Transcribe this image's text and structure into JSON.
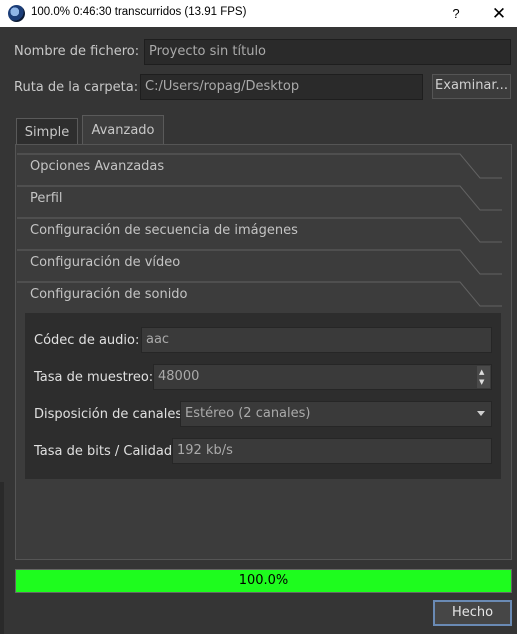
{
  "window": {
    "title": "100.0%  0:46:30 transcurridos (13.91 FPS)",
    "help_glyph": "?",
    "close_glyph": "✕"
  },
  "form": {
    "filename_label": "Nombre de fichero:",
    "filename_value": "Proyecto sin título",
    "folder_label": "Ruta de la carpeta:",
    "folder_value": "C:/Users/ropag/Desktop",
    "browse_label": "Examinar..."
  },
  "tabs": [
    {
      "label": "Simple",
      "selected": false
    },
    {
      "label": "Avanzado",
      "selected": true
    }
  ],
  "sections": [
    "Opciones Avanzadas",
    "Perfil",
    "Configuración de secuencia de imágenes",
    "Configuración de vídeo",
    "Configuración de sonido"
  ],
  "audio": {
    "codec_label": "Códec de audio:",
    "codec_value": "aac",
    "samplerate_label": "Tasa de muestreo:",
    "samplerate_value": "48000",
    "channels_label": "Disposición de canales:",
    "channels_value": "Estéreo (2 canales)",
    "bitrate_label": "Tasa de bits / Calidad:",
    "bitrate_value": "192 kb/s"
  },
  "progress": {
    "percent": 100.0,
    "text": "100.0%",
    "color": "#1efc1e"
  },
  "done_label": "Hecho",
  "icons": {
    "app": "openshot-app-icon",
    "spin_up": "▲",
    "spin_down": "▼"
  }
}
